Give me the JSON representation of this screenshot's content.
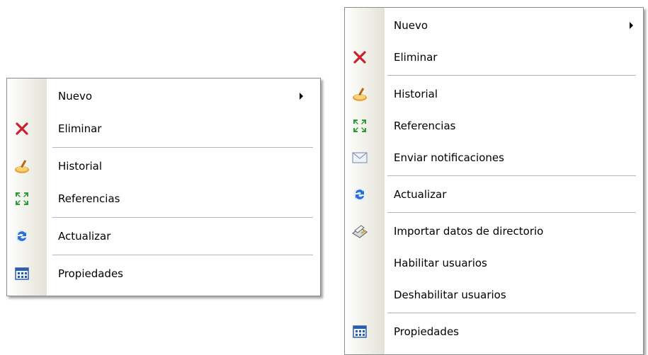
{
  "menu_left": {
    "items": [
      {
        "label": "Nuevo",
        "icon": "none",
        "submenu": true
      },
      {
        "label": "Eliminar",
        "icon": "delete-x-icon"
      },
      {
        "label": "Historial",
        "icon": "history-icon"
      },
      {
        "label": "Referencias",
        "icon": "references-icon"
      },
      {
        "label": "Actualizar",
        "icon": "refresh-icon"
      },
      {
        "label": "Propiedades",
        "icon": "properties-icon"
      }
    ]
  },
  "menu_right": {
    "items": [
      {
        "label": "Nuevo",
        "icon": "none",
        "submenu": true
      },
      {
        "label": "Eliminar",
        "icon": "delete-x-icon"
      },
      {
        "label": "Historial",
        "icon": "history-icon"
      },
      {
        "label": "Referencias",
        "icon": "references-icon"
      },
      {
        "label": "Enviar notificaciones",
        "icon": "envelope-icon"
      },
      {
        "label": "Actualizar",
        "icon": "refresh-icon"
      },
      {
        "label": "Importar datos de directorio",
        "icon": "import-directory-icon"
      },
      {
        "label": "Habilitar usuarios",
        "icon": "none"
      },
      {
        "label": "Deshabilitar usuarios",
        "icon": "none"
      },
      {
        "label": "Propiedades",
        "icon": "properties-icon"
      }
    ]
  },
  "colors": {
    "delete": "#cc1f2f",
    "references": "#2e9a3a",
    "refresh": "#2a6fd6",
    "properties": "#2a5db0"
  }
}
